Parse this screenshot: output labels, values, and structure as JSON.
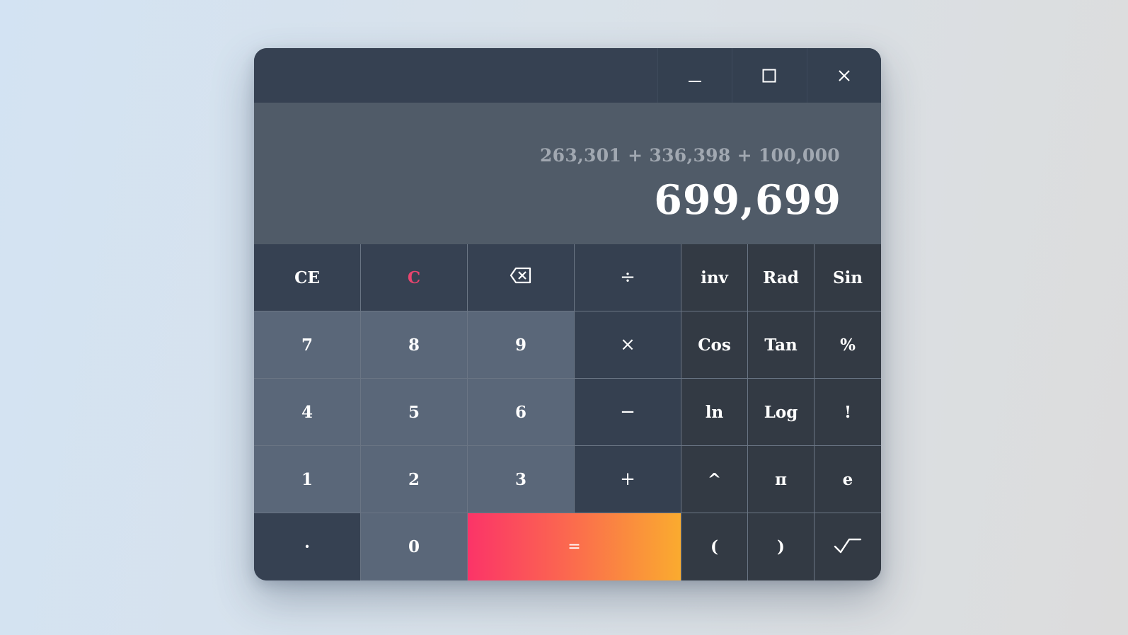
{
  "window": {
    "controls": {
      "minimize_icon": "minimize-icon",
      "maximize_icon": "maximize-icon",
      "close_icon": "close-icon"
    }
  },
  "display": {
    "expression": "263,301 + 336,398 + 100,000",
    "result": "699,699"
  },
  "keys": {
    "row1": [
      "CE",
      "C",
      "backspace-icon",
      "÷",
      "inv",
      "Rad",
      "Sin"
    ],
    "row2": [
      "7",
      "8",
      "9",
      "×",
      "Cos",
      "Tan",
      "%"
    ],
    "row3": [
      "4",
      "5",
      "6",
      "−",
      "ln",
      "Log",
      "!"
    ],
    "row4": [
      "1",
      "2",
      "3",
      "+",
      "^",
      "π",
      "e"
    ],
    "row5": [
      "·",
      "0",
      "=",
      "(",
      ")",
      "sqrt-icon"
    ],
    "labels": {
      "ce": "CE",
      "c": "C",
      "divide": "÷",
      "inv": "inv",
      "rad": "Rad",
      "sin": "Sin",
      "seven": "7",
      "eight": "8",
      "nine": "9",
      "multiply": "×",
      "cos": "Cos",
      "tan": "Tan",
      "percent": "%",
      "four": "4",
      "five": "5",
      "six": "6",
      "minus": "−",
      "ln": "ln",
      "log": "Log",
      "factorial": "!",
      "one": "1",
      "two": "2",
      "three": "3",
      "plus": "+",
      "power": "^",
      "pi": "π",
      "e": "e",
      "decimal": "·",
      "zero": "0",
      "equals": "=",
      "open_paren": "(",
      "close_paren": ")"
    }
  },
  "colors": {
    "background": "#d9e2ea",
    "titlebar": "#364152",
    "display": "#505b68",
    "digit_key": "#5a6779",
    "operator_key": "#354050",
    "scientific_key": "#333a44",
    "clear_accent": "#e8456f",
    "equals_gradient_start": "#fb3468",
    "equals_gradient_end": "#faab2f",
    "expression_text": "#a1a8b1",
    "result_text": "#ffffff"
  }
}
